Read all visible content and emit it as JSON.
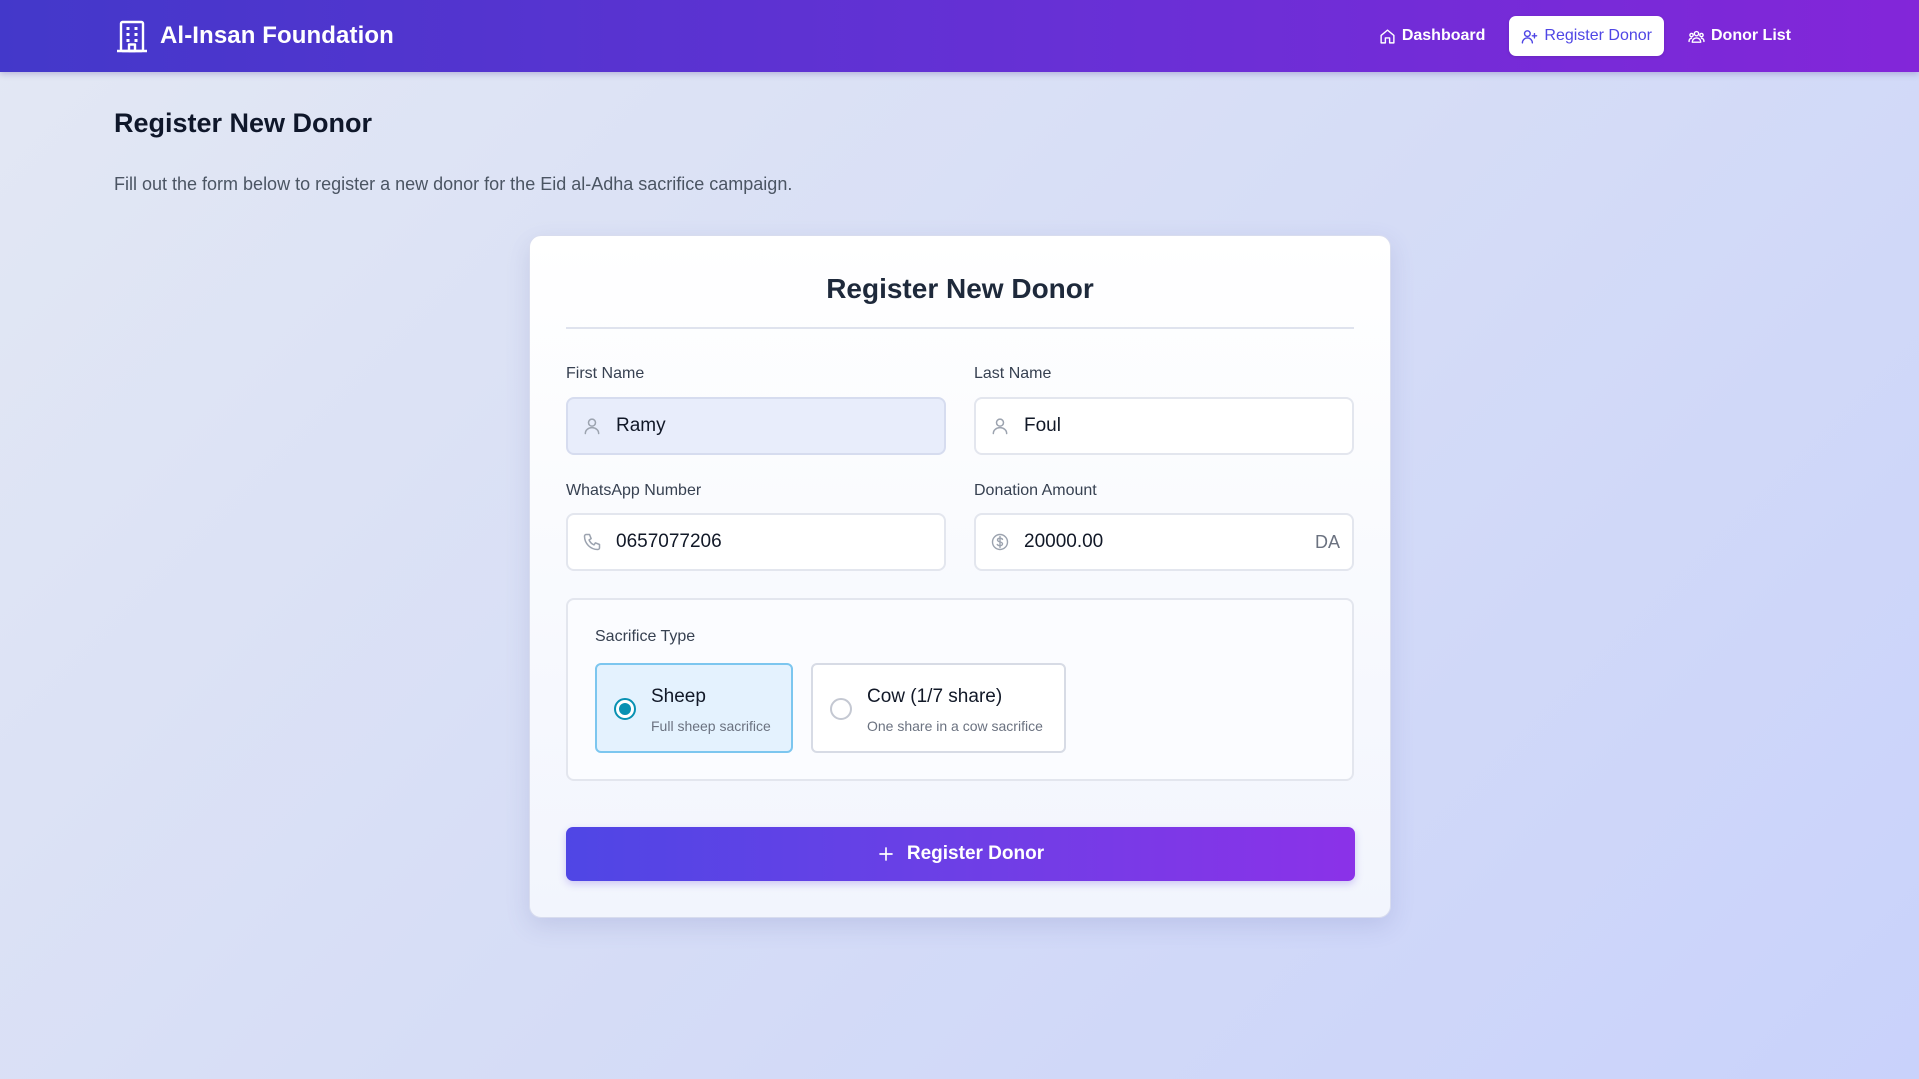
{
  "app": {
    "brand": "Al-Insan Foundation"
  },
  "nav": {
    "items": [
      {
        "label": "Dashboard",
        "icon": "home-icon",
        "active": false
      },
      {
        "label": "Register Donor",
        "icon": "user-plus-icon",
        "active": true
      },
      {
        "label": "Donor List",
        "icon": "users-icon",
        "active": false
      }
    ]
  },
  "page": {
    "title": "Register New Donor",
    "description": "Fill out the form below to register a new donor for the Eid al-Adha sacrifice campaign."
  },
  "form": {
    "title": "Register New Donor",
    "first_name": {
      "label": "First Name",
      "value": "Ramy",
      "icon": "user-icon"
    },
    "last_name": {
      "label": "Last Name",
      "value": "Foul",
      "icon": "user-icon"
    },
    "whatsapp": {
      "label": "WhatsApp Number",
      "value": "0657077206",
      "icon": "phone-icon"
    },
    "donation": {
      "label": "Donation Amount",
      "value": "20000.00",
      "suffix": "DA",
      "icon": "dollar-circle-icon"
    },
    "sacrifice": {
      "label": "Sacrifice Type",
      "options": [
        {
          "title": "Sheep",
          "subtitle": "Full sheep sacrifice",
          "selected": true
        },
        {
          "title": "Cow (1/7 share)",
          "subtitle": "One share in a cow sacrifice",
          "selected": false
        }
      ]
    },
    "submit_label": "Register Donor"
  },
  "colors": {
    "header_start": "#4338ca",
    "header_end": "#8326d9",
    "accent": "#4f46e5",
    "radio_selected": "#0891b2"
  }
}
